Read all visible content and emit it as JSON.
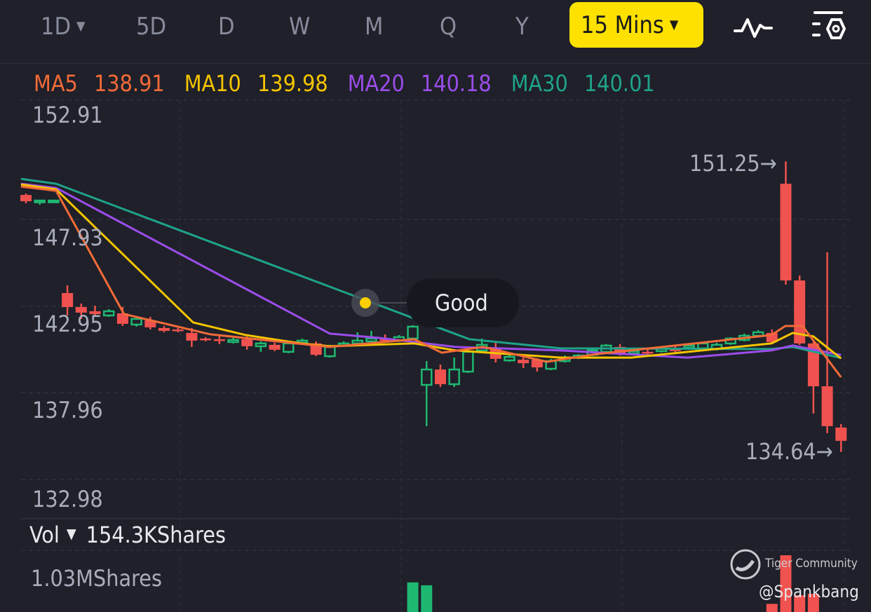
{
  "toolbar": {
    "tabs": [
      {
        "label": "1D",
        "has_dropdown": true
      },
      {
        "label": "5D"
      },
      {
        "label": "D"
      },
      {
        "label": "W"
      },
      {
        "label": "M"
      },
      {
        "label": "Q"
      },
      {
        "label": "Y"
      }
    ],
    "interval": {
      "label": "15 Mins",
      "active": true,
      "color": "#ffe100"
    },
    "icons": [
      "indicator-wave-icon",
      "chart-settings-icon"
    ]
  },
  "ma_legend": [
    {
      "label": "MA5",
      "value": "138.91",
      "color": "#f26b38"
    },
    {
      "label": "MA10",
      "value": "139.98",
      "color": "#f5c400"
    },
    {
      "label": "MA20",
      "value": "140.18",
      "color": "#9b4dea"
    },
    {
      "label": "MA30",
      "value": "140.01",
      "color": "#1fa38a"
    }
  ],
  "price_axis": [
    "152.91",
    "147.93",
    "142.95",
    "137.96",
    "132.98"
  ],
  "markers": {
    "high": "151.25",
    "low": "134.64"
  },
  "tooltip": {
    "text": "Good"
  },
  "volume": {
    "label": "Vol",
    "value": "154.3KShares",
    "axis_max": "1.03MShares"
  },
  "watermark": {
    "brand": "Tiger Community",
    "user": "@Spankbang"
  },
  "colors": {
    "up": "#1fb872",
    "down": "#f0524f",
    "background": "#1f2029"
  },
  "chart_data": {
    "type": "candlestick",
    "interval": "15 Mins",
    "ylim": [
      132.98,
      152.91
    ],
    "grid": true,
    "candles_ohlc": [
      [
        149.33,
        149.41,
        148.85,
        148.97
      ],
      [
        148.93,
        149.05,
        148.77,
        149.01
      ],
      [
        149.01,
        149.05,
        148.97,
        149.01
      ],
      [
        143.72,
        144.16,
        142.44,
        142.92
      ],
      [
        142.92,
        143.12,
        142.24,
        142.6
      ],
      [
        142.68,
        143.0,
        142.36,
        142.52
      ],
      [
        142.44,
        142.8,
        142.36,
        142.68
      ],
      [
        142.56,
        142.92,
        141.84,
        141.96
      ],
      [
        141.92,
        142.36,
        141.8,
        142.24
      ],
      [
        142.16,
        142.36,
        141.64,
        141.76
      ],
      [
        141.72,
        141.84,
        141.48,
        141.56
      ],
      [
        141.64,
        141.72,
        141.48,
        141.56
      ],
      [
        141.44,
        141.72,
        140.64,
        141.0
      ],
      [
        141.12,
        141.2,
        140.96,
        141.04
      ],
      [
        141.08,
        141.32,
        140.8,
        141.04
      ],
      [
        140.92,
        141.16,
        140.84,
        141.04
      ],
      [
        141.08,
        141.24,
        140.48,
        140.68
      ],
      [
        140.68,
        140.96,
        140.36,
        140.84
      ],
      [
        140.76,
        140.88,
        140.4,
        140.48
      ],
      [
        140.36,
        140.92,
        140.28,
        140.84
      ],
      [
        140.88,
        141.12,
        140.8,
        141.0
      ],
      [
        140.84,
        140.96,
        140.11,
        140.19
      ],
      [
        140.11,
        140.76,
        140.03,
        140.64
      ],
      [
        140.72,
        140.96,
        140.64,
        140.84
      ],
      [
        140.84,
        141.48,
        140.76,
        141.0
      ],
      [
        140.96,
        141.56,
        140.88,
        141.12
      ],
      [
        141.08,
        141.36,
        140.92,
        141.0
      ],
      [
        141.0,
        141.32,
        140.92,
        141.2
      ],
      [
        141.12,
        141.88,
        141.04,
        141.8
      ],
      [
        138.47,
        139.83,
        136.11,
        139.35
      ],
      [
        139.35,
        139.63,
        138.35,
        138.51
      ],
      [
        138.51,
        140.03,
        138.35,
        139.35
      ],
      [
        139.23,
        140.52,
        139.15,
        140.36
      ],
      [
        140.44,
        141.12,
        140.36,
        140.76
      ],
      [
        140.6,
        140.92,
        139.75,
        139.96
      ],
      [
        139.87,
        140.19,
        139.79,
        140.07
      ],
      [
        139.91,
        140.03,
        139.43,
        139.71
      ],
      [
        139.91,
        139.99,
        139.23,
        139.47
      ],
      [
        139.39,
        139.95,
        139.31,
        139.83
      ],
      [
        139.83,
        140.15,
        139.75,
        140.03
      ],
      [
        140.03,
        140.23,
        139.95,
        140.15
      ],
      [
        140.19,
        140.56,
        140.11,
        140.44
      ],
      [
        140.36,
        140.8,
        140.28,
        140.72
      ],
      [
        140.64,
        140.8,
        140.15,
        140.28
      ],
      [
        140.28,
        140.48,
        140.19,
        140.4
      ],
      [
        140.36,
        140.48,
        140.15,
        140.28
      ],
      [
        140.4,
        140.68,
        140.32,
        140.56
      ],
      [
        140.52,
        140.68,
        140.32,
        140.4
      ],
      [
        140.6,
        140.84,
        140.52,
        140.72
      ],
      [
        140.56,
        140.92,
        140.48,
        140.84
      ],
      [
        140.52,
        140.88,
        140.44,
        140.76
      ],
      [
        140.84,
        141.2,
        140.76,
        141.12
      ],
      [
        141.04,
        141.4,
        140.96,
        141.28
      ],
      [
        141.28,
        141.6,
        141.2,
        141.48
      ],
      [
        141.44,
        141.64,
        140.84,
        140.92
      ],
      [
        149.97,
        151.25,
        144.2,
        144.44
      ],
      [
        144.44,
        144.72,
        140.76,
        140.84
      ],
      [
        140.84,
        140.92,
        136.83,
        138.39
      ],
      [
        138.39,
        146.05,
        135.71,
        136.11
      ],
      [
        136.03,
        136.23,
        134.64,
        135.27
      ]
    ],
    "moving_averages": [
      {
        "name": "MA30",
        "points": [
          [
            0.64,
            150.25
          ],
          [
            3.18,
            149.97
          ],
          [
            33.1,
            141.08
          ],
          [
            39.7,
            140.56
          ],
          [
            54.96,
            140.52
          ],
          [
            56.5,
            140.64
          ],
          [
            60,
            140.01
          ]
        ]
      },
      {
        "name": "MA20",
        "points": [
          [
            0.64,
            149.97
          ],
          [
            3.18,
            149.73
          ],
          [
            23.0,
            141.4
          ],
          [
            26.5,
            141.16
          ],
          [
            29.1,
            140.92
          ],
          [
            32.1,
            140.64
          ],
          [
            39.7,
            140.44
          ],
          [
            48.9,
            140.03
          ],
          [
            54.96,
            140.44
          ],
          [
            56.5,
            140.72
          ],
          [
            60,
            140.18
          ]
        ]
      },
      {
        "name": "MA10",
        "points": [
          [
            0.64,
            149.93
          ],
          [
            3.18,
            149.65
          ],
          [
            13.1,
            142.04
          ],
          [
            16.9,
            141.32
          ],
          [
            20.9,
            140.84
          ],
          [
            23.0,
            140.68
          ],
          [
            29.1,
            140.84
          ],
          [
            32.1,
            140.44
          ],
          [
            39.7,
            140.03
          ],
          [
            44.8,
            140.03
          ],
          [
            54.96,
            140.84
          ],
          [
            56.5,
            141.44
          ],
          [
            58.0,
            141.24
          ],
          [
            60,
            139.98
          ]
        ]
      },
      {
        "name": "MA5",
        "points": [
          [
            0.64,
            149.81
          ],
          [
            3.18,
            149.57
          ],
          [
            8.1,
            142.52
          ],
          [
            14.35,
            141.36
          ],
          [
            23.0,
            140.64
          ],
          [
            29.1,
            141.08
          ],
          [
            31.1,
            140.31
          ],
          [
            34.1,
            140.64
          ],
          [
            38.7,
            139.79
          ],
          [
            42.3,
            140.23
          ],
          [
            54.96,
            141.32
          ],
          [
            55.97,
            141.84
          ],
          [
            57.2,
            141.84
          ],
          [
            60,
            138.91
          ]
        ]
      }
    ],
    "volume_visible_bars": [
      {
        "candle": 29,
        "shares": 830000,
        "dir": "up"
      },
      {
        "candle": 30,
        "shares": 810000,
        "dir": "up"
      },
      {
        "candle": 55,
        "shares": 680000,
        "dir": "down"
      },
      {
        "candle": 56,
        "shares": 1020000,
        "dir": "down"
      },
      {
        "candle": 57,
        "shares": 740000,
        "dir": "down"
      },
      {
        "candle": 58,
        "shares": 750000,
        "dir": "down"
      }
    ],
    "volume_max": 1030000
  }
}
